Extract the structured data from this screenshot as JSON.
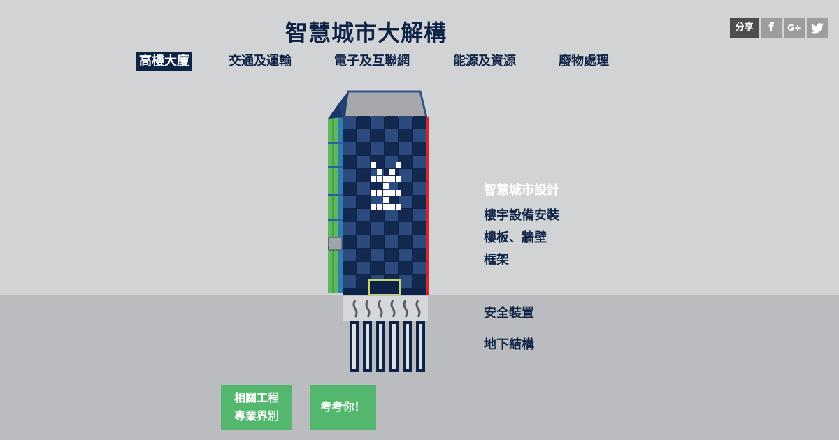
{
  "title": "智慧城市大解構",
  "nav": {
    "tabs": [
      {
        "label": "高樓大廈",
        "active": true
      },
      {
        "label": "交通及運輸",
        "active": false
      },
      {
        "label": "電子及互聯網",
        "active": false
      },
      {
        "label": "能源及資源",
        "active": false
      },
      {
        "label": "廢物處理",
        "active": false
      }
    ]
  },
  "share": {
    "label": "分享",
    "facebook_icon": "f",
    "googleplus_icon": "G+",
    "twitter_icon": "twitter-bird"
  },
  "building": {
    "sign_icon": "yen-symbol"
  },
  "hotspots": [
    {
      "label": "智慧城市設計",
      "highlighted": true
    },
    {
      "label": "樓宇設備安裝",
      "highlighted": false
    },
    {
      "label": "樓板、牆壁",
      "highlighted": false
    },
    {
      "label": "框架",
      "highlighted": false
    },
    {
      "label": "安全裝置",
      "highlighted": false
    },
    {
      "label": "地下結構",
      "highlighted": false
    }
  ],
  "buttons": {
    "related_line1": "相關工程",
    "related_line2": "專業界別",
    "quiz": "考考你！"
  },
  "colors": {
    "navy": "#0e2447",
    "accent_green": "#53b86d",
    "sky": "#d2d3d5",
    "ground": "#bbbcbf"
  }
}
